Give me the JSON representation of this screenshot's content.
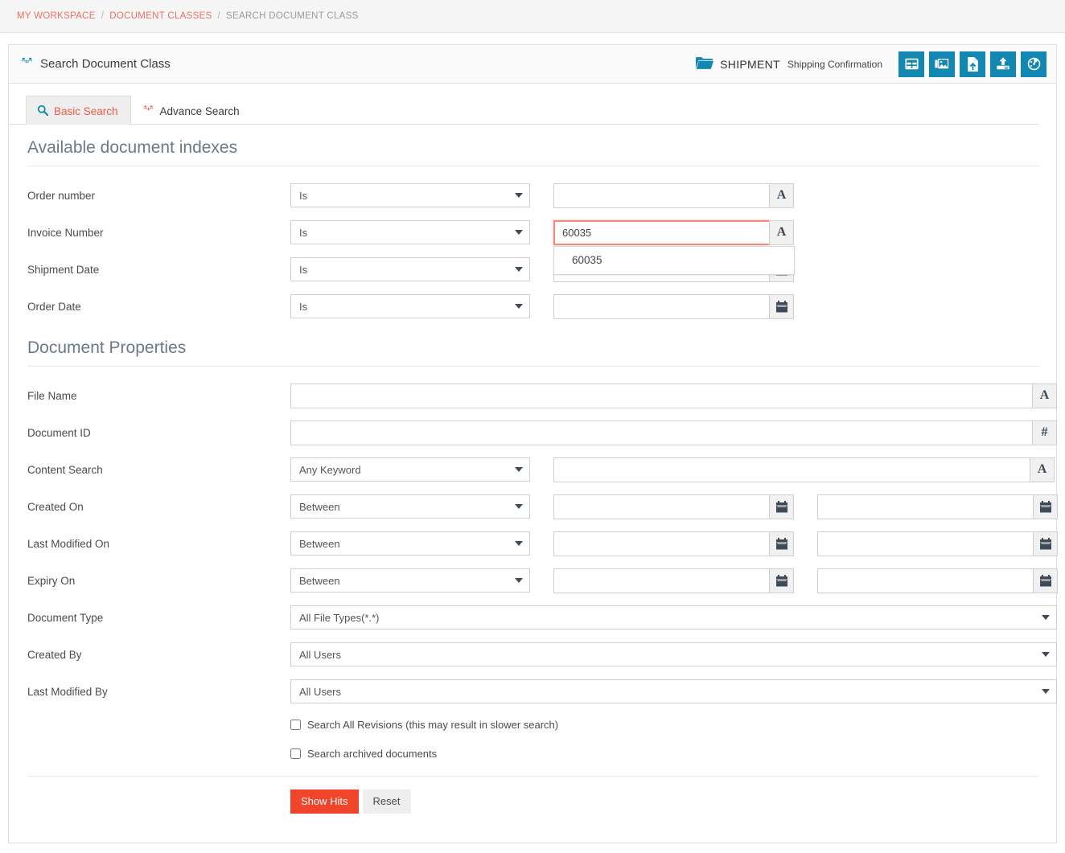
{
  "breadcrumb": {
    "items": [
      {
        "label": "MY WORKSPACE",
        "current": false
      },
      {
        "label": "DOCUMENT CLASSES",
        "current": false
      },
      {
        "label": "SEARCH DOCUMENT CLASS",
        "current": true
      }
    ],
    "separator": "/",
    "link_color": "#ec7060",
    "current_color": "#9a9a9a"
  },
  "header": {
    "title": "Search Document Class",
    "title_icon": "binoculars-icon",
    "folder_icon": "folder-icon",
    "folder_name": "SHIPMENT",
    "folder_subtitle": "Shipping Confirmation",
    "accent_color": "#1287b1",
    "actions": [
      {
        "name": "grid-view-icon",
        "tooltip": "Grid View"
      },
      {
        "name": "image-gallery-icon",
        "tooltip": "Image Gallery"
      },
      {
        "name": "file-upload-icon",
        "tooltip": "Upload File"
      },
      {
        "name": "upload-icon",
        "tooltip": "Upload"
      },
      {
        "name": "dashboard-icon",
        "tooltip": "Dashboard"
      }
    ]
  },
  "tabs": [
    {
      "label": "Basic Search",
      "icon": "search-icon",
      "active": true
    },
    {
      "label": "Advance Search",
      "icon": "binoculars-icon",
      "active": false
    }
  ],
  "sections": {
    "indexes": {
      "title": "Available document indexes",
      "rows": [
        {
          "label": "Order number",
          "condition": "Is",
          "value": "",
          "addon": "A",
          "addon_name": "text-type-icon",
          "focused": false
        },
        {
          "label": "Invoice Number",
          "condition": "Is",
          "value": "60035",
          "addon": "A",
          "addon_name": "text-type-icon",
          "focused": true
        },
        {
          "label": "Shipment Date",
          "condition": "Is",
          "value": "",
          "addon": "calendar",
          "addon_name": "calendar-icon",
          "focused": false
        },
        {
          "label": "Order Date",
          "condition": "Is",
          "value": "",
          "addon": "calendar",
          "addon_name": "calendar-icon",
          "focused": false
        }
      ],
      "autocomplete": {
        "visible": true,
        "for_field": "Invoice Number",
        "options": [
          "60035"
        ]
      }
    },
    "properties": {
      "title": "Document Properties",
      "file_name": {
        "label": "File Name",
        "value": "",
        "addon": "A",
        "addon_name": "text-type-icon"
      },
      "document_id": {
        "label": "Document ID",
        "value": "",
        "addon": "#",
        "addon_name": "number-type-icon"
      },
      "content_search": {
        "label": "Content Search",
        "condition": "Any Keyword",
        "value": "",
        "addon": "A",
        "addon_name": "text-type-icon"
      },
      "date_ranges": [
        {
          "label": "Created On",
          "condition": "Between",
          "from": "",
          "to": ""
        },
        {
          "label": "Last Modified On",
          "condition": "Between",
          "from": "",
          "to": ""
        },
        {
          "label": "Expiry On",
          "condition": "Between",
          "from": "",
          "to": ""
        }
      ],
      "selects": [
        {
          "label": "Document Type",
          "value": "All File Types(*.*)"
        },
        {
          "label": "Created By",
          "value": "All Users"
        },
        {
          "label": "Last Modified By",
          "value": "All Users"
        }
      ],
      "checkboxes": [
        {
          "label": "Search All Revisions (this may result in slower search)",
          "checked": false
        },
        {
          "label": "Search archived documents",
          "checked": false
        }
      ]
    }
  },
  "footer": {
    "submit_label": "Show Hits",
    "reset_label": "Reset",
    "submit_color": "#f0452a"
  }
}
